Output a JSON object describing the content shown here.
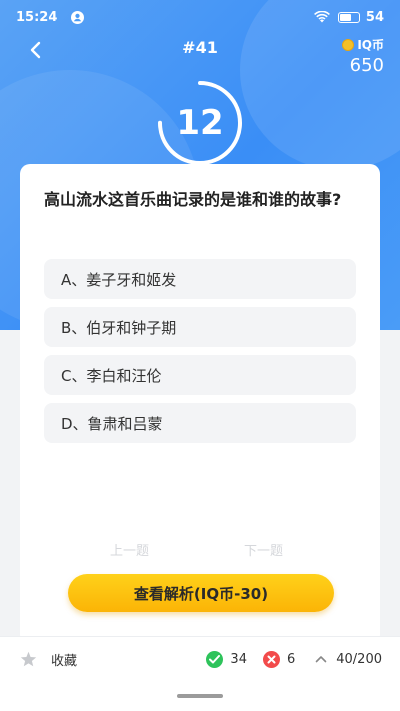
{
  "status_bar": {
    "time": "15:24",
    "battery_level": "54",
    "icons": [
      "account-circle-icon",
      "wifi-icon",
      "battery-icon"
    ]
  },
  "header": {
    "question_number": "#41",
    "coin_label": "IQ币",
    "coin_balance": "650"
  },
  "timer": {
    "seconds": "12",
    "remaining_fraction": 0.75
  },
  "question": {
    "text": "高山流水这首乐曲记录的是谁和谁的故事?",
    "options": [
      {
        "label": "A、姜子牙和姬发"
      },
      {
        "label": "B、伯牙和钟子期"
      },
      {
        "label": "C、李白和汪伦"
      },
      {
        "label": "D、鲁肃和吕蒙"
      }
    ]
  },
  "navigation": {
    "prev_label": "上一题",
    "next_label": "下一题"
  },
  "analysis_button": {
    "label": "查看解析(IQ币-30)"
  },
  "bottom_bar": {
    "favorite_label": "收藏",
    "correct_count": "34",
    "wrong_count": "6",
    "progress": "40/200"
  },
  "colors": {
    "primary_blue": "#3a8ef6",
    "button_yellow": "#fbb406",
    "correct_green": "#2ec35b",
    "wrong_red": "#f24b4b"
  }
}
